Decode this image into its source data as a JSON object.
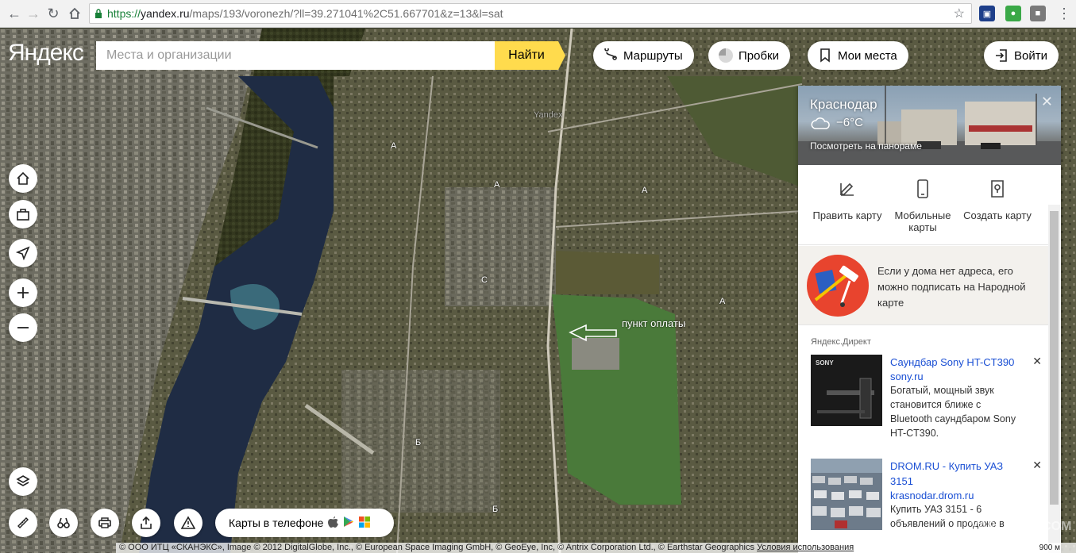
{
  "browser": {
    "url_scheme": "https://",
    "url_host": "yandex.ru",
    "url_path": "/maps/193/voronezh/?ll=39.271041%2C51.667701&z=13&l=sat"
  },
  "header": {
    "logo": "Яндекс",
    "search_placeholder": "Места и организации",
    "find_label": "Найти",
    "routes_label": "Маршруты",
    "traffic_label": "Пробки",
    "myplaces_label": "Мои места",
    "login_label": "Войти"
  },
  "map": {
    "annotation": "пункт оплаты",
    "letters": [
      "A",
      "A",
      "A",
      "A",
      "C",
      "Б",
      "Б"
    ],
    "watermark_text": "Yandex",
    "phone_label": "Карты в телефоне"
  },
  "panel": {
    "city": "Краснодар",
    "temperature": "−6°C",
    "panorama_link": "Посмотреть на панораме",
    "actions": [
      {
        "label": "Править карту",
        "icon": "edit-icon"
      },
      {
        "label": "Мобильные карты",
        "icon": "mobile-icon"
      },
      {
        "label": "Создать карту",
        "icon": "map-pin-icon"
      }
    ],
    "promo_text": "Если у дома нет адреса, его можно подписать на Народной карте",
    "direct_label": "Яндекс.Директ",
    "ads": [
      {
        "title": "Саундбар Sony HT-CT390",
        "domain": "sony.ru",
        "text": "Богатый, мощный звук становится ближе с Bluetooth саундбаром Sony HT-CT390.",
        "brand": "SONY"
      },
      {
        "title": "DROM.RU - Купить УАЗ 3151",
        "domain": "krasnodar.drom.ru",
        "text": "Купить УАЗ 3151 - 6 объявлений о продаже в"
      }
    ]
  },
  "footer": {
    "attribution": "© ООО ИТЦ «СКАНЭКС», Image © 2012 DigitalGlobe, Inc., © European Space Imaging GmbH, © GeoEye, Inc, © Antrix Corporation Ltd., © Earthstar Geographics",
    "terms": "Условия использования",
    "scale": "900 м"
  },
  "watermark": "YAPLAKAL.COM",
  "colors": {
    "accent": "#ffdb4d",
    "link": "#1a4fd4",
    "secure": "#188038"
  }
}
